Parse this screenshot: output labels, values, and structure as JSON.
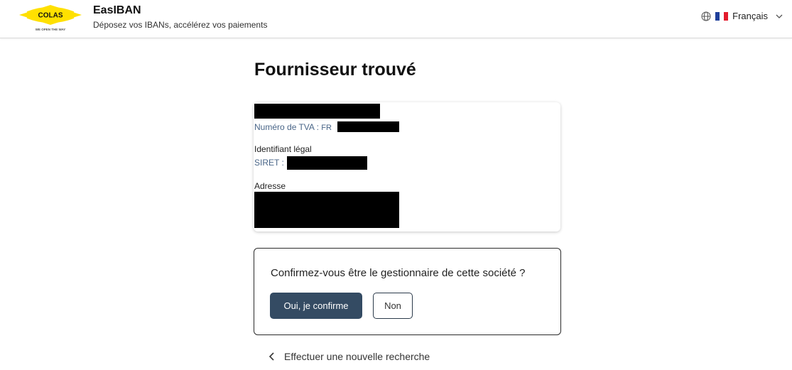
{
  "header": {
    "logo_text": "COLAS",
    "logo_tagline": "WE OPEN THE WAY",
    "title": "EasIBAN",
    "subtitle": "Déposez vos IBANs, accélérez vos paiements",
    "language": "Français",
    "colors": {
      "logo_yellow": "#ffe000",
      "flag_blue": "#1f3f9a",
      "flag_red": "#e21b2c"
    }
  },
  "main": {
    "title": "Fournisseur trouvé",
    "supplier": {
      "vat_label": "Numéro de TVA :",
      "vat_prefix": "FR",
      "legal_id_label": "Identifiant légal",
      "siret_label": "SIRET :",
      "address_label": "Adresse"
    },
    "confirm": {
      "question": "Confirmez-vous être le gestionnaire de cette société ?",
      "yes_label": "Oui, je confirme",
      "no_label": "Non"
    },
    "new_search_label": "Effectuer une nouvelle recherche"
  }
}
